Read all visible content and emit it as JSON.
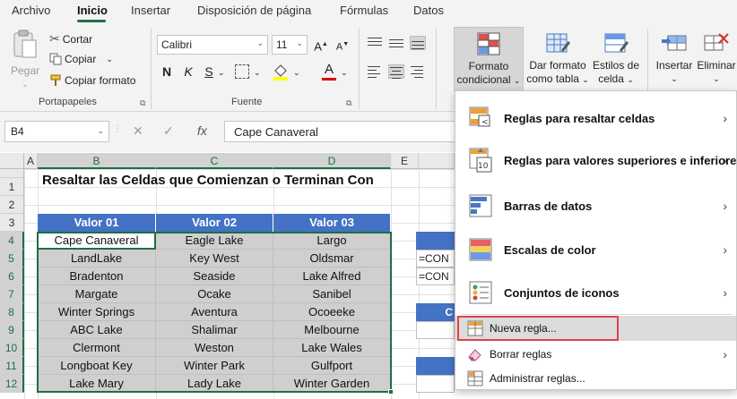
{
  "tabs": [
    "Archivo",
    "Inicio",
    "Insertar",
    "Disposición de página",
    "Fórmulas",
    "Datos"
  ],
  "active_tab": "Inicio",
  "ribbon": {
    "clipboard": {
      "paste": "Pegar",
      "cut": "Cortar",
      "copy": "Copiar",
      "copy_format": "Copiar formato",
      "group_label": "Portapapeles"
    },
    "font": {
      "font_name": "Calibri",
      "font_size": "11",
      "bold": "N",
      "italic": "K",
      "underline": "S",
      "group_label": "Fuente",
      "fill_color": "#ffff00",
      "font_color": "#e00000"
    },
    "styles": {
      "conditional_format": [
        "Formato",
        "condicional"
      ],
      "format_as_table": [
        "Dar formato",
        "como tabla"
      ],
      "cell_styles": [
        "Estilos de",
        "celda"
      ]
    },
    "cells": {
      "insert": "Insertar",
      "delete": "Eliminar"
    }
  },
  "formula_bar": {
    "name_box": "B4",
    "fx": "fx",
    "content": "Cape Canaveral"
  },
  "columns": [
    "A",
    "B",
    "C",
    "D",
    "E"
  ],
  "rows": [
    "1",
    "2",
    "3",
    "4",
    "5",
    "6",
    "7",
    "8",
    "9",
    "10",
    "11",
    "12"
  ],
  "sheet": {
    "title": "Resaltar las Celdas que Comienzan o Terminan Con",
    "headers": [
      "Valor 01",
      "Valor 02",
      "Valor 03"
    ],
    "data": [
      [
        "Cape Canaveral",
        "Eagle Lake",
        "Largo"
      ],
      [
        "LandLake",
        "Key West",
        "Oldsmar"
      ],
      [
        "Bradenton",
        "Seaside",
        "Lake Alfred"
      ],
      [
        "Margate",
        "Ocake",
        "Sanibel"
      ],
      [
        "Winter Springs",
        "Aventura",
        "Ocoeeke"
      ],
      [
        "ABC Lake",
        "Shalimar",
        "Melbourne"
      ],
      [
        "Clermont",
        "Weston",
        "Lake Wales"
      ],
      [
        "Longboat Key",
        "Winter Park",
        "Gulfport"
      ],
      [
        "Lake Mary",
        "Lady Lake",
        "Winter Garden"
      ]
    ],
    "side_formula_1": "=CON",
    "side_formula_2": "=CON",
    "side_partial": "C"
  },
  "menu": {
    "items": [
      {
        "label": "Reglas para resaltar celdas",
        "has_submenu": true
      },
      {
        "label": "Reglas para valores superiores e inferiores",
        "has_submenu": true
      },
      {
        "label": "Barras de datos",
        "has_submenu": true
      },
      {
        "label": "Escalas de color",
        "has_submenu": true
      },
      {
        "label": "Conjuntos de iconos",
        "has_submenu": true
      },
      {
        "label": "Nueva regla...",
        "has_submenu": false
      },
      {
        "label": "Borrar reglas",
        "has_submenu": true
      },
      {
        "label": "Administrar reglas...",
        "has_submenu": false
      }
    ],
    "highlight_color": "#e0404a"
  },
  "colors": {
    "excel_green": "#1e6f42",
    "header_blue": "#4472c4",
    "data_gray": "#d0cece"
  }
}
